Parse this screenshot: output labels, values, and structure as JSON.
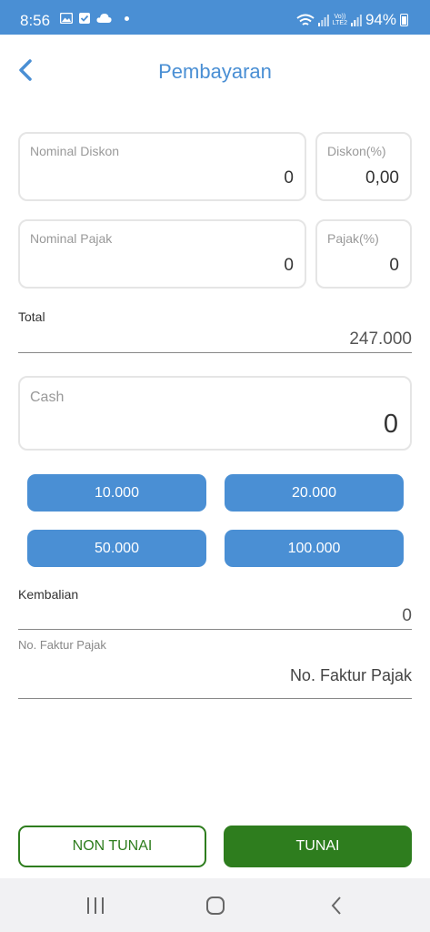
{
  "status_bar": {
    "time": "8:56",
    "battery": "94%",
    "network_label_top": "Vo))",
    "network_label_bottom": "LTE2"
  },
  "header": {
    "title": "Pembayaran"
  },
  "discount": {
    "nominal_label": "Nominal Diskon",
    "nominal_value": "0",
    "percent_label": "Diskon(%)",
    "percent_value": "0,00"
  },
  "tax": {
    "nominal_label": "Nominal Pajak",
    "nominal_value": "0",
    "percent_label": "Pajak(%)",
    "percent_value": "0"
  },
  "total": {
    "label": "Total",
    "value": "247.000"
  },
  "cash": {
    "label": "Cash",
    "value": "0"
  },
  "quick_amounts": [
    "10.000",
    "20.000",
    "50.000",
    "100.000"
  ],
  "change": {
    "label": "Kembalian",
    "value": "0"
  },
  "tax_invoice": {
    "label": "No. Faktur Pajak",
    "placeholder": "No. Faktur Pajak"
  },
  "actions": {
    "non_cash": "NON TUNAI",
    "cash": "TUNAI"
  },
  "colors": {
    "primary": "#4a8fd4",
    "success": "#2e7d1e"
  }
}
